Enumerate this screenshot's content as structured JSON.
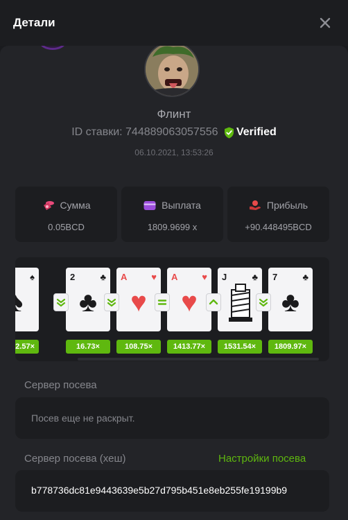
{
  "header": {
    "title": "Детали",
    "close_icon": "close-icon"
  },
  "player": {
    "name": "Флинт",
    "avatar_icon": "player-avatar"
  },
  "bet": {
    "id_label": "ID ставки:",
    "id_value": "744889063057556",
    "verified_label": "Verified",
    "timestamp": "06.10.2021, 13:53:26"
  },
  "stats": [
    {
      "label": "Сумма",
      "value": "0.05BCD",
      "icon": "coins-icon",
      "color": "#e84a7a"
    },
    {
      "label": "Выплата",
      "value": "1809.9699 x",
      "icon": "wallet-icon",
      "color": "#9b4ddb"
    },
    {
      "label": "Прибыль",
      "value": "+90.448495BCD",
      "icon": "profit-icon",
      "color": "#e84a4a"
    }
  ],
  "cards": [
    {
      "rank": "",
      "suit": "♠",
      "color": "black",
      "multiplier": "2.57×"
    },
    {
      "rank": "2",
      "suit": "♣",
      "color": "black",
      "multiplier": "16.73×"
    },
    {
      "rank": "A",
      "suit": "♥",
      "color": "red",
      "multiplier": "108.75×"
    },
    {
      "rank": "A",
      "suit": "♥",
      "color": "red",
      "multiplier": "1413.77×"
    },
    {
      "rank": "J",
      "suit": "♣",
      "color": "black",
      "multiplier": "1531.54×"
    },
    {
      "rank": "7",
      "suit": "♣",
      "color": "black",
      "multiplier": "1809.97×"
    }
  ],
  "guesses": [
    {
      "type": "lower",
      "icon": "chevron-double-down-icon"
    },
    {
      "type": "lower",
      "icon": "chevron-double-down-icon"
    },
    {
      "type": "equal",
      "icon": "equal-icon"
    },
    {
      "type": "higher",
      "icon": "chevron-up-icon"
    },
    {
      "type": "lower",
      "icon": "chevron-double-down-icon"
    }
  ],
  "colors": {
    "accent_green": "#5fb80f"
  },
  "server_seed": {
    "label": "Сервер посева",
    "value": "Посев еще не раскрыт."
  },
  "server_seed_hash": {
    "label": "Сервер посева (хеш)",
    "settings_link": "Настройки посева",
    "value": "b778736dc81e9443639e5b27d795b451e8eb255fe19199b9"
  }
}
